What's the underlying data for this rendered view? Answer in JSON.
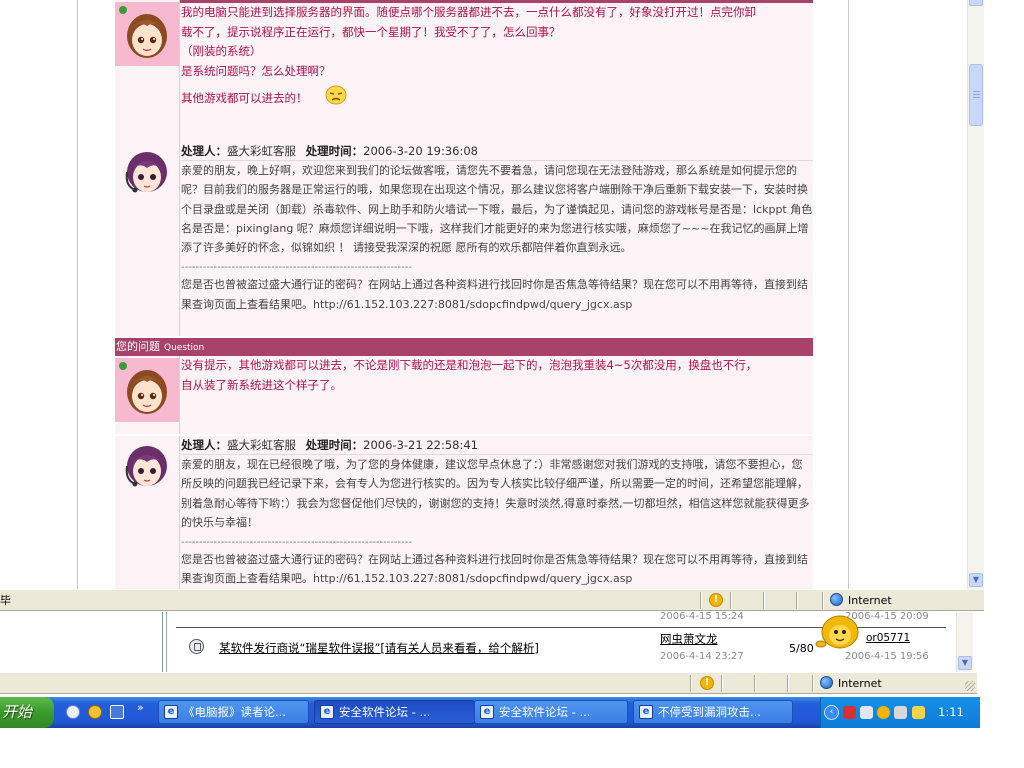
{
  "thread": {
    "post1": {
      "lines": [
        "我的电脑只能进到选择服务器的界面。随便点哪个服务器都进不去，一点什么都没有了，好象没打开过！点完你卸",
        "载不了，提示说程序正在运行，都快一个星期了！我受不了了，怎么回事？",
        "（刚装的系统）",
        "是系统问题吗？怎么处理啊？",
        "其他游戏都可以进去的！"
      ]
    },
    "answer1": {
      "handler_label": "处理人：",
      "handler": "盛大彩虹客服",
      "time_label": "处理时间：",
      "time": "2006-3-20 19:36:08",
      "text": "亲爱的朋友，晚上好啊，欢迎您来到我们的论坛做客哦，请您先不要着急，请问您现在无法登陆游戏，那么系统是如何提示您的呢？目前我们的服务器是正常运行的哦，如果您现在出现这个情况，那么建议您将客户端删除干净后重新下载安装一下，安装时换个目录盘或是关闭（卸载）杀毒软件、网上助手和防火墙试一下哦，最后，为了谨慎起见，请问您的游戏帐号是否是：lckppt 角色名是否是：pixinglang 呢？麻烦您详细说明一下哦，这样我们才能更好的来为您进行核实哦，麻烦您了~~~在我记忆的画屏上增添了许多美好的怀念，似锦如织 ！ 请接受我深深的祝愿 愿所有的欢乐都陪伴着你直到永远。",
      "divider": "----------------------------------------------------------------",
      "promo": "您是否也曾被盗过盛大通行证的密码？在网站上通过各种资料进行找回时你是否焦急等待结果？现在您可以不用再等待，直接到结果查询页面上查看结果吧。http://61.152.103.227:8081/sdopcfindpwd/query_jgcx.asp"
    },
    "question_header": {
      "cn": "您的问题",
      "en": "Question"
    },
    "post2": {
      "lines": [
        "没有提示，其他游戏都可以进去，不论是刚下载的还是和泡泡一起下的，泡泡我重装4~5次都没用，换盘也不行，",
        "自从装了新系统进这个样子了。"
      ]
    },
    "answer2": {
      "handler_label": "处理人：",
      "handler": "盛大彩虹客服",
      "time_label": "处理时间：",
      "time": "2006-3-21 22:58:41",
      "text": "亲爱的朋友，现在已经很晚了哦，为了您的身体健康，建议您早点休息了：）非常感谢您对我们游戏的支持哦，请您不要担心，您所反映的问题我已经记录下来，会有专人为您进行核实的。因为专人核实比较仔细严谨，所以需要一定的时间，还希望您能理解，别着急耐心等待下哟：）我会为您督促他们尽快的，谢谢您的支持！失意时淡然,得意时泰然,一切都坦然，相信这样您就能获得更多的快乐与幸福！",
      "divider": "----------------------------------------------------------------",
      "promo": "您是否也曾被盗过盛大通行证的密码？在网站上通过各种资料进行找回时你是否焦急等待结果？现在您可以不用再等待，直接到结果查询页面上查看结果吧。http://61.152.103.227:8081/sdopcfindpwd/query_jgcx.asp"
    }
  },
  "statusbar1": {
    "left_fragment": "毕",
    "zone": "Internet"
  },
  "bg_window": {
    "ts_top_left": "2006-4-15 15:24",
    "ts_top_right": "2006-4-15 20:09",
    "topic_title": "某软件发行商说“瑞星软件误报”[请有关人员来看看，给个解析]",
    "author": "网虫萧文龙",
    "author_date": "2006-4-14 23:27",
    "reply_count": "5/80",
    "last_user": "or05771",
    "last_date": "2006-4-15 19:56"
  },
  "statusbar2": {
    "zone": "Internet"
  },
  "taskbar": {
    "start_label": "开始",
    "chevron": "»",
    "buttons": [
      {
        "label": "《电脑报》读者论..."
      },
      {
        "label": "安全软件论坛 - ..."
      },
      {
        "label": "安全软件论坛 - ..."
      },
      {
        "label": "不停受到漏洞攻击..."
      }
    ],
    "clock": "1:11"
  }
}
